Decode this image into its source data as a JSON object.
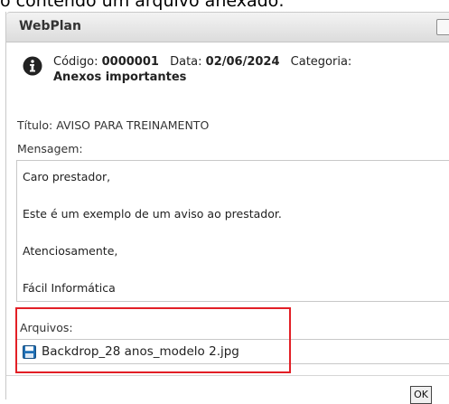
{
  "caption": "o contendo um arquivo anexado:",
  "dialog": {
    "title": "WebPlan",
    "meta": {
      "codigo_label": "Código:",
      "codigo_value": "0000001",
      "data_label": "Data:",
      "data_value": "02/06/2024",
      "categoria_label": "Categoria:",
      "categoria_value": "Anexos importantes"
    },
    "titulo_text": "Título: AVISO PARA TREINAMENTO",
    "mensagem_label": "Mensagem:",
    "message_lines": [
      "Caro prestador,",
      "Este é um exemplo de um aviso ao prestador.",
      "Atenciosamente,",
      "Fácil Informática"
    ],
    "arquivos_label": "Arquivos:",
    "file_name": "Backdrop_28 anos_modelo 2.jpg",
    "ok_label": "OK"
  },
  "colors": {
    "highlight": "#e21f26",
    "file_icon": "#1f6fb5"
  },
  "icons": {
    "info": "info-icon",
    "file": "floppy-disk-icon"
  }
}
